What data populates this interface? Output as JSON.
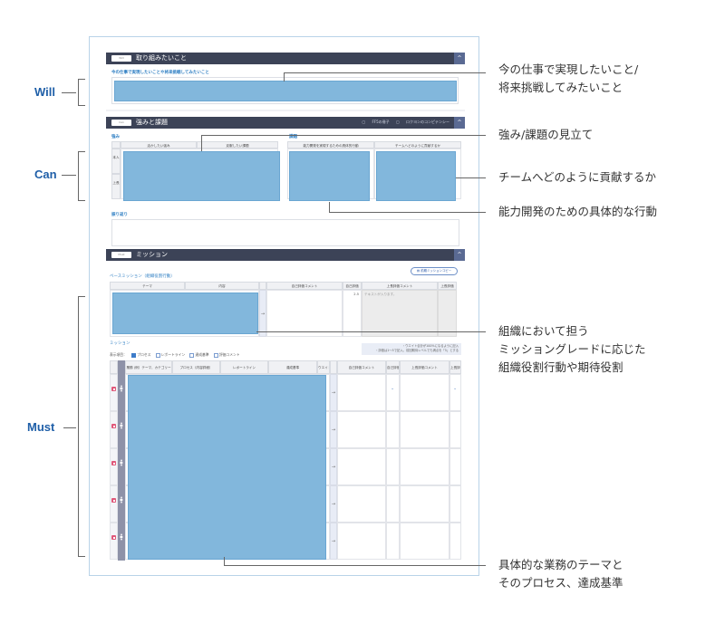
{
  "annotations_left": [
    {
      "label": "Will"
    },
    {
      "label": "Can"
    },
    {
      "label": "Must"
    }
  ],
  "annotations_right": [
    {
      "lines": [
        "今の仕事で実現したいこと/",
        "将来挑戦してみたいこと"
      ]
    },
    {
      "lines": [
        "強み/課題の見立て"
      ]
    },
    {
      "lines": [
        "チームへどのように貢献するか"
      ]
    },
    {
      "lines": [
        "能力開発のための具体的な行動"
      ]
    },
    {
      "lines": [
        "組織において担う",
        "ミッショングレードに応じた",
        "組織役割行動や期待役割"
      ]
    },
    {
      "lines": [
        "具体的な業務のテーマと",
        "そのプロセス、達成基準"
      ]
    }
  ],
  "will_section": {
    "tag": "Will",
    "title": "取り組みたいこと",
    "field_label": "今の仕事で実現したいことや将来挑戦してみたいこと",
    "collapse_icon": "^"
  },
  "can_section": {
    "tag": "Can",
    "title": "強みと課題",
    "links": [
      "FF5の冊子",
      "ロクヨンのコンピテンシー"
    ],
    "collapse_icon": "^",
    "strengths_label": "強み",
    "issues_label": "課題",
    "headers": [
      "活かしたい強み",
      "克服したい課題",
      "能力開発を実現するための具体的行動",
      "チームへどのように貢献するか"
    ],
    "row_labels": [
      "本人",
      "上長"
    ],
    "reflection_label": "振り返り"
  },
  "must_section": {
    "tag": "Must",
    "title": "ミッション",
    "collapse_icon": "^",
    "copy_button": "前期ミッションコピー",
    "base_mission_label": "ベースミッション（組織役割行動）",
    "base_headers": [
      "テーマ",
      "内容",
      "自己評価コメント",
      "自己評価",
      "上長評価コメント",
      "上長評価"
    ],
    "base_row": {
      "self_score": "2.5",
      "boss_comment": "テキストが入ります。"
    },
    "mission_label": "ミッション",
    "notes": [
      "・ウエイト合計が100%になるように記入",
      "・評価は1〜5で記入。前回期待レベルでも満点を「5」とする"
    ],
    "display_label": "表示項目：",
    "display_options": [
      {
        "label": "プロセス",
        "checked": true
      },
      {
        "label": "レポートライン",
        "checked": false
      },
      {
        "label": "達成基準",
        "checked": false
      },
      {
        "label": "評価コメント",
        "checked": false
      }
    ],
    "mission_headers": [
      "業務\n(例）テーマ、カテゴリー",
      "プロセス（内容詳細）",
      "レポートライン",
      "達成基準",
      "ウエイト",
      "自己評価コメント",
      "自己評価",
      "上長評価コメント",
      "上長評価"
    ],
    "row_count": 5
  }
}
